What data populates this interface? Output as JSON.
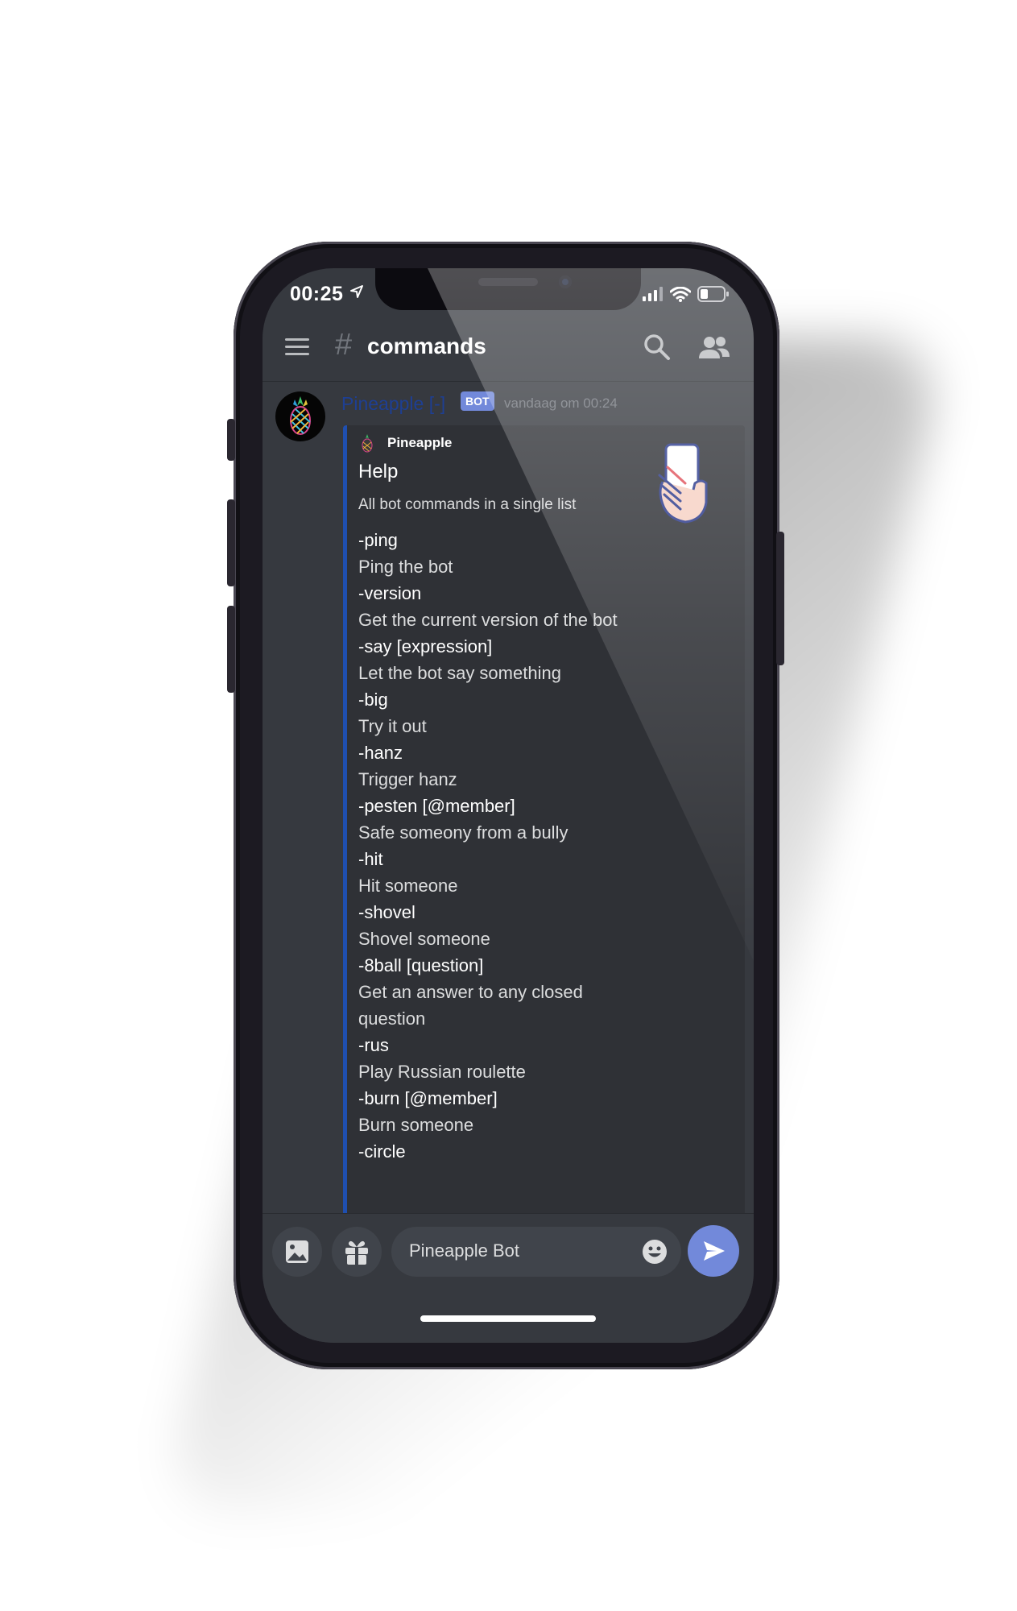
{
  "status_bar": {
    "time": "00:25"
  },
  "header": {
    "hash": "#",
    "channel": "commands"
  },
  "message": {
    "author": "Pineapple [-]",
    "bot_tag": "BOT",
    "timestamp": "vandaag om 00:24",
    "embed": {
      "author": "Pineapple",
      "title": "Help",
      "description": "All bot commands in a single list",
      "accent_color": "#1f4fb0",
      "fields": [
        {
          "name": "-ping",
          "value": "Ping the bot"
        },
        {
          "name": "-version",
          "value": "Get the current version of the bot"
        },
        {
          "name": "-say [expression]",
          "value": "Let the bot say something"
        },
        {
          "name": "-big",
          "value": "Try it out"
        },
        {
          "name": "-hanz",
          "value": "Trigger hanz"
        },
        {
          "name": "-pesten [@member]",
          "value": "Safe someony from a bully"
        },
        {
          "name": "-hit",
          "value": "Hit someone"
        },
        {
          "name": "-shovel",
          "value": "Shovel someone"
        },
        {
          "name": "-8ball [question]",
          "value": "Get an answer to any closed question"
        },
        {
          "name": "-rus",
          "value": "Play Russian roulette"
        },
        {
          "name": "-burn [@member]",
          "value": "Burn someone"
        },
        {
          "name": "-circle",
          "value": ""
        }
      ]
    }
  },
  "composer": {
    "input_value": "Pineapple Bot",
    "send_color": "#7289da"
  },
  "theme": {
    "background": "#36393f",
    "embed_background": "#2f3136",
    "blurple": "#7289da"
  },
  "icons": [
    "menu-icon",
    "search-icon",
    "members-icon",
    "image-icon",
    "gift-icon",
    "emoji-icon",
    "send-icon",
    "signal-icon",
    "wifi-icon",
    "battery-icon",
    "location-arrow-icon"
  ]
}
